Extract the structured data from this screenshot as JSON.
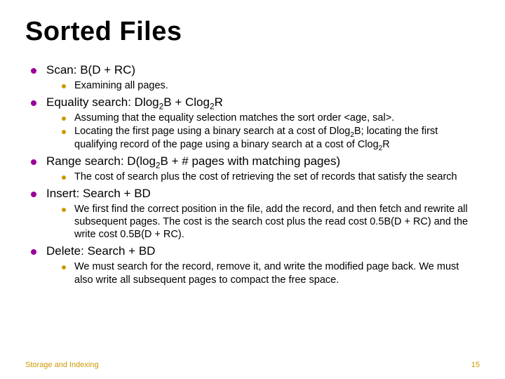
{
  "title": "Sorted Files",
  "items": [
    {
      "heading_html": "Scan: B(D + RC)",
      "sub": [
        {
          "text_html": "Examining all pages."
        }
      ]
    },
    {
      "heading_html": "Equality search: Dlog<sub>2</sub>B + Clog<sub>2</sub>R",
      "sub": [
        {
          "text_html": "Assuming that the equality selection matches the sort order &lt;age, sal&gt;."
        },
        {
          "text_html": "Locating the first page using a binary search at a cost of Dlog<sub>2</sub>B; locating the first qualifying record of the page using a binary search at a cost of Clog<sub>2</sub>R"
        }
      ]
    },
    {
      "heading_html": "Range search: D(log<sub>2</sub>B + # pages with matching pages)",
      "sub": [
        {
          "text_html": "The cost of search plus the cost of retrieving the set of records that satisfy the search"
        }
      ]
    },
    {
      "heading_html": "Insert: Search + BD",
      "sub": [
        {
          "text_html": "We first find the correct position in the file, add the record, and then fetch and rewrite all subsequent pages. The cost is the search cost plus the read cost 0.5B(D + RC) and the write cost 0.5B(D + RC)."
        }
      ]
    },
    {
      "heading_html": "Delete: Search + BD",
      "sub": [
        {
          "text_html": "We must search for the record, remove it, and write the modified page back. We must also write all subsequent pages to compact the free space."
        }
      ]
    }
  ],
  "footer": {
    "left": "Storage and Indexing",
    "right": "15"
  }
}
